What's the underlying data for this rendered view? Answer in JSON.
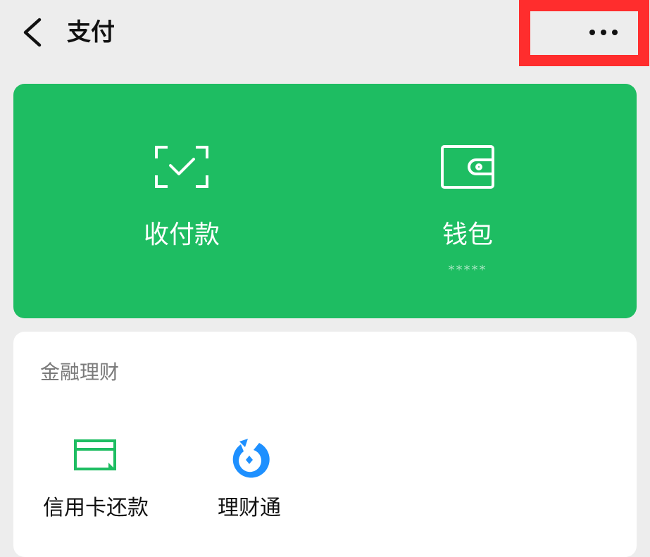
{
  "header": {
    "title": "支付",
    "back_icon": "chevron-left-icon",
    "more_icon": "ellipsis-icon",
    "highlight_color": "#ff2d2d"
  },
  "payment_card": {
    "background": "#1ebd62",
    "entries": [
      {
        "label": "收付款",
        "icon": "scan-check-icon"
      },
      {
        "label": "钱包",
        "sub": "*****",
        "icon": "wallet-icon"
      }
    ]
  },
  "finance": {
    "title": "金融理财",
    "items": [
      {
        "label": "信用卡还款",
        "icon": "credit-card-repay-icon",
        "color": "#1ebd62"
      },
      {
        "label": "理财通",
        "icon": "licaitong-icon",
        "color": "#1e90ff"
      }
    ]
  }
}
